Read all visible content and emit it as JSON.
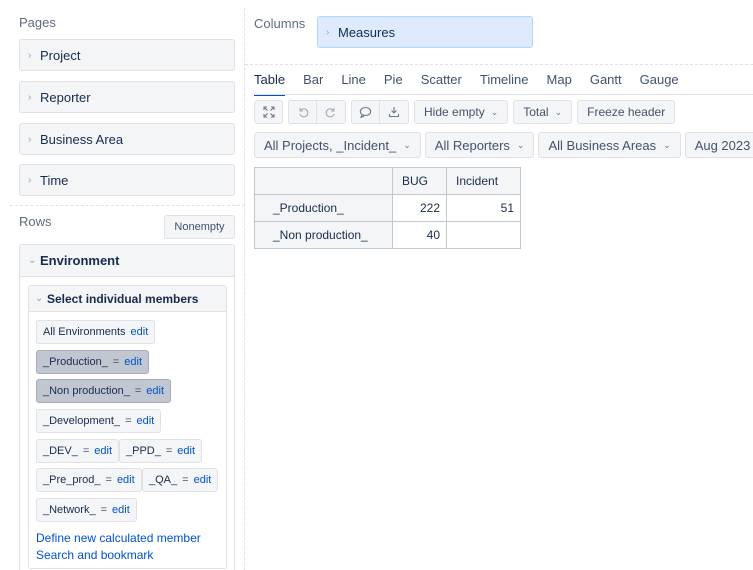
{
  "pages": {
    "title": "Pages",
    "items": [
      {
        "label": "Project"
      },
      {
        "label": "Reporter"
      },
      {
        "label": "Business Area"
      },
      {
        "label": "Time"
      }
    ]
  },
  "rows": {
    "title": "Rows",
    "nonempty_label": "Nonempty",
    "dimension": "Environment",
    "select_title": "Select individual members",
    "members": [
      {
        "label": "All Environments",
        "eq": "",
        "edit": "edit"
      },
      {
        "label": "_Production_",
        "eq": "=",
        "edit": "edit"
      },
      {
        "label": "_Non production_",
        "eq": "=",
        "edit": "edit"
      },
      {
        "label": "_Development_",
        "eq": "=",
        "edit": "edit"
      },
      {
        "label": "_DEV_",
        "eq": "=",
        "edit": "edit"
      },
      {
        "label": "_PPD_",
        "eq": "=",
        "edit": "edit"
      },
      {
        "label": "_Pre_prod_",
        "eq": "=",
        "edit": "edit"
      },
      {
        "label": "_QA_",
        "eq": "=",
        "edit": "edit"
      },
      {
        "label": "_Network_",
        "eq": "=",
        "edit": "edit"
      }
    ],
    "define_link": "Define new calculated member",
    "search_link": "Search and bookmark"
  },
  "columns": {
    "title": "Columns",
    "measures": "Measures"
  },
  "tabs": [
    "Table",
    "Bar",
    "Line",
    "Pie",
    "Scatter",
    "Timeline",
    "Map",
    "Gantt",
    "Gauge"
  ],
  "toolbar": {
    "hide_empty": "Hide empty",
    "total": "Total",
    "freeze_header": "Freeze header"
  },
  "filters": [
    "All Projects, _Incident_",
    "All Reporters",
    "All Business Areas",
    "Aug 2023"
  ],
  "table": {
    "headers": [
      "BUG",
      "Incident"
    ],
    "rows": [
      {
        "label": "_Production_",
        "values": [
          "222",
          "51"
        ]
      },
      {
        "label": "_Non production_",
        "values": [
          "40",
          ""
        ]
      }
    ]
  }
}
